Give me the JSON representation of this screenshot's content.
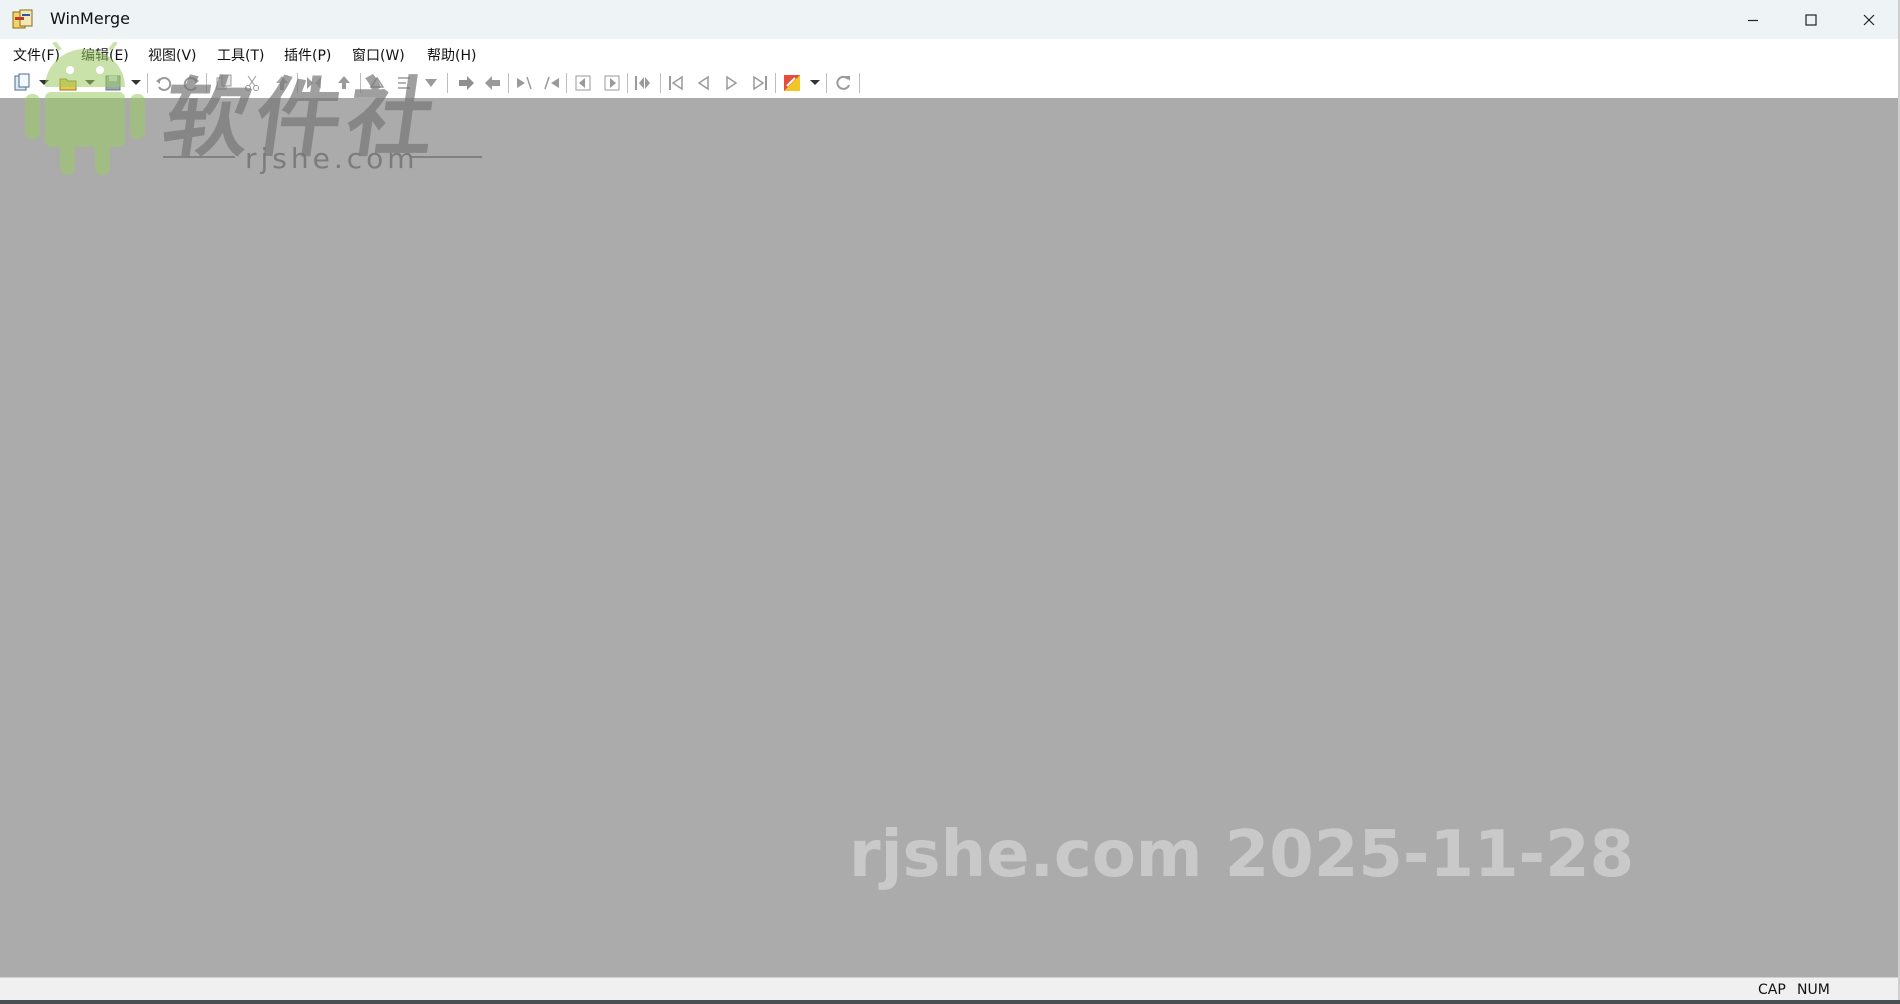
{
  "window": {
    "title": "WinMerge",
    "icon": "winmerge-app-icon",
    "controls": {
      "minimize": "minimize-icon",
      "maximize": "maximize-icon",
      "close": "close-icon"
    }
  },
  "menu": {
    "items": [
      {
        "label": "文件(F)"
      },
      {
        "label": "编辑(E)"
      },
      {
        "label": "视图(V)"
      },
      {
        "label": "工具(T)"
      },
      {
        "label": "插件(P)"
      },
      {
        "label": "窗口(W)"
      },
      {
        "label": "帮助(H)"
      }
    ]
  },
  "toolbar": {
    "buttons": [
      "new-icon",
      "open-icon",
      "save-icon",
      "undo-icon",
      "redo-icon",
      "copy-icon",
      "cut-icon",
      "paste-icon",
      "merge-left-icon",
      "merge-right-icon",
      "prev-diff-icon",
      "next-diff-icon",
      "current-diff-icon",
      "copy-right-icon",
      "copy-left-icon",
      "copy-right-advance-icon",
      "copy-left-advance-icon",
      "first-conflict-icon",
      "last-conflict-icon",
      "all-right-icon",
      "first-diff-icon",
      "prev-diff2-icon",
      "next-diff2-icon",
      "last-diff-icon",
      "options-icon",
      "refresh-icon"
    ]
  },
  "status": {
    "cap": "CAP",
    "num": "NUM"
  },
  "watermarks": {
    "brand_cn": "软件社",
    "brand_domain": "rjshe.com",
    "bottom": "rjshe.com 2025-11-28"
  },
  "colors": {
    "workspace": "#ababab",
    "titlebar": "#eef3f6",
    "statusbar": "#f0f0f0"
  }
}
